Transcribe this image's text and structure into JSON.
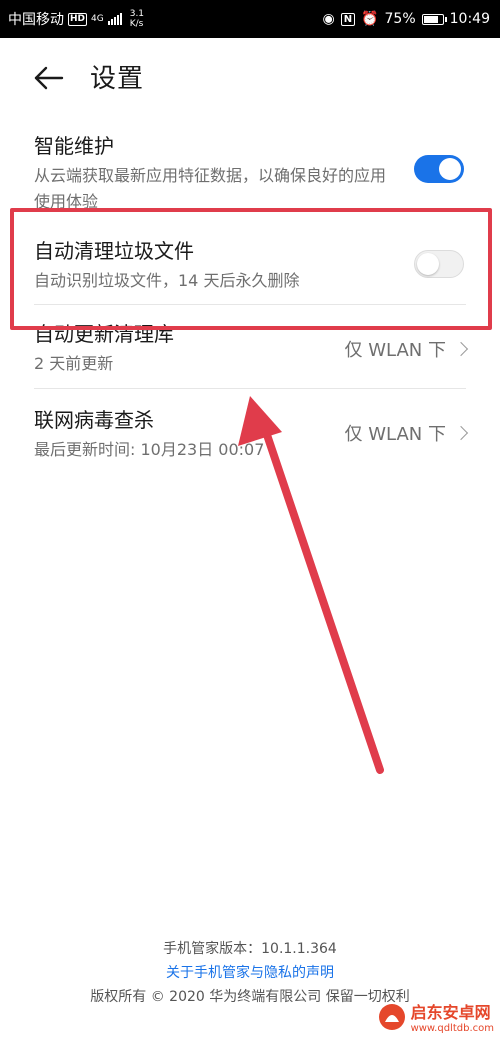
{
  "status_bar": {
    "carrier": "中国移动",
    "hd": "HD",
    "network": "4G",
    "speed_value": "3.1",
    "speed_unit": "K/s",
    "battery": "75%",
    "time": "10:49",
    "icons": [
      "eye-icon",
      "nfc-icon",
      "alarm-icon"
    ]
  },
  "header": {
    "title": "设置"
  },
  "items": [
    {
      "title": "智能维护",
      "subtitle": "从云端获取最新应用特征数据，以确保良好的应用使用体验",
      "control": "toggle",
      "toggle_on": true
    },
    {
      "title": "自动清理垃圾文件",
      "subtitle": "自动识别垃圾文件，14 天后永久删除",
      "control": "toggle",
      "toggle_on": false
    },
    {
      "title": "自动更新清理库",
      "subtitle": "2 天前更新",
      "control": "value",
      "value": "仅 WLAN 下"
    },
    {
      "title": "联网病毒查杀",
      "subtitle": "最后更新时间: 10月23日 00:07",
      "control": "value",
      "value": "仅 WLAN 下"
    }
  ],
  "footer": {
    "version": "手机管家版本：10.1.1.364",
    "privacy_link": "关于手机管家与隐私的声明",
    "copyright": "版权所有 © 2020 华为终端有限公司 保留一切权利"
  },
  "watermark": {
    "name": "启东安卓网",
    "url": "www.qdltdb.com"
  },
  "colors": {
    "accent": "#1a73e8",
    "highlight": "#e03c4b",
    "arrow": "#e03c4b"
  }
}
